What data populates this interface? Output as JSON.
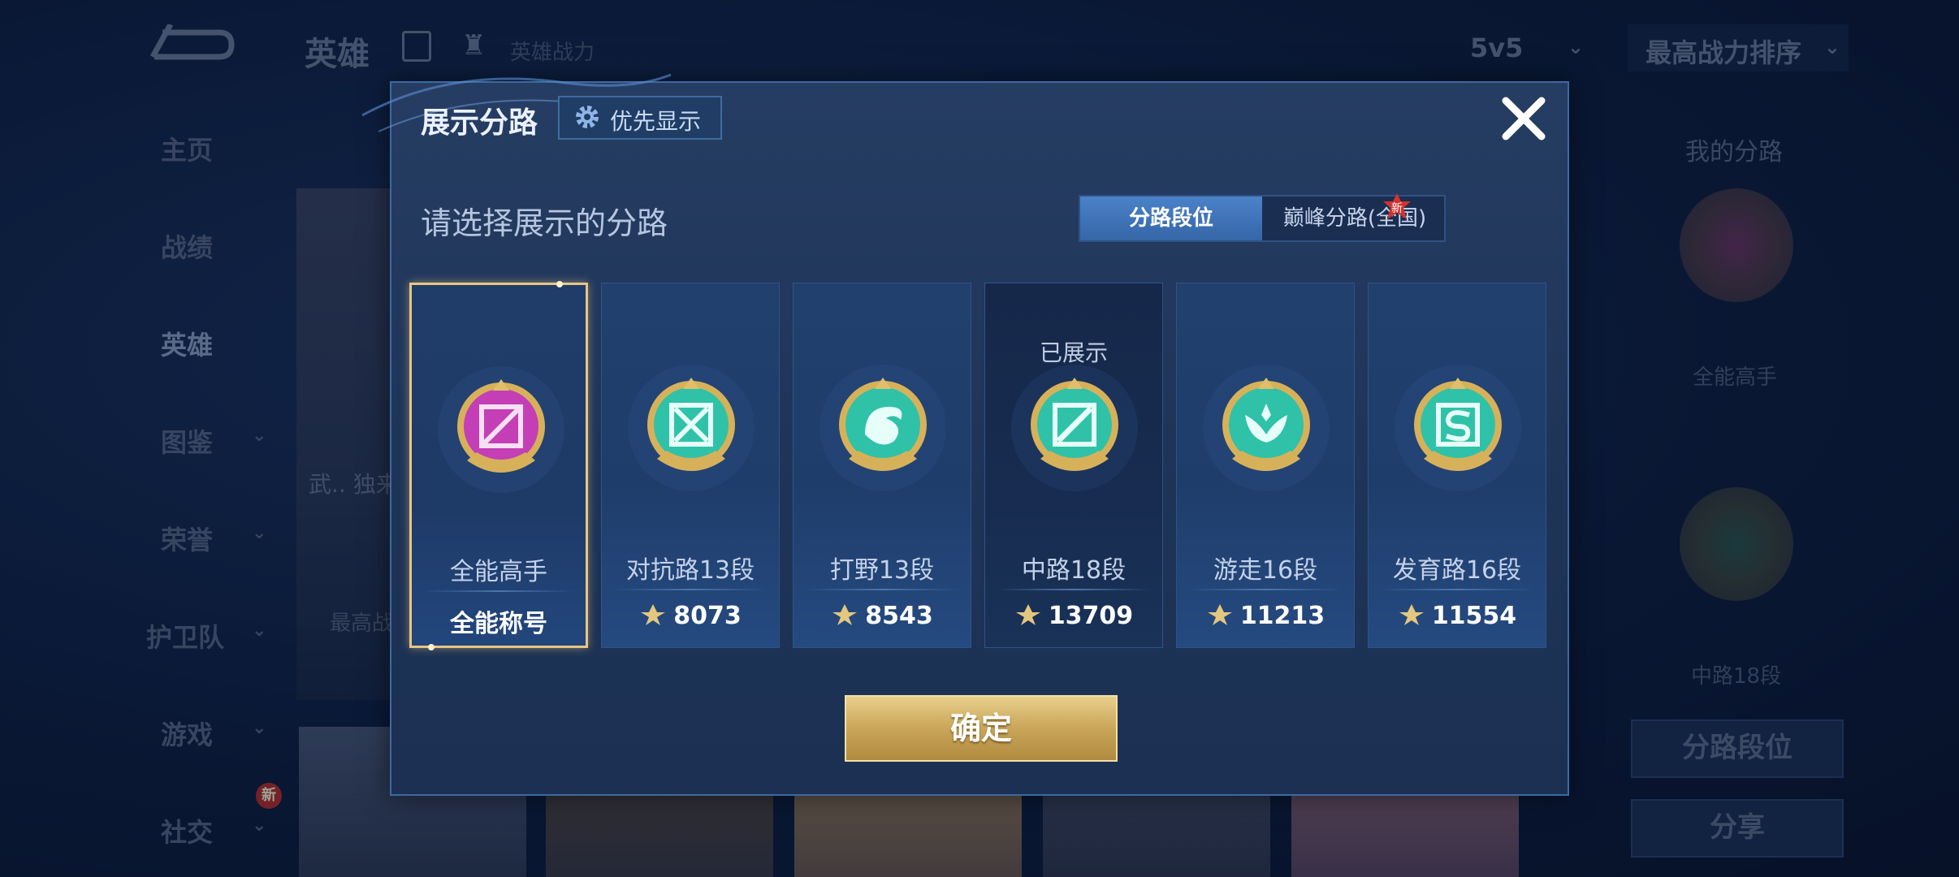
{
  "background": {
    "top_bar": {
      "title": "英雄",
      "power_label": "英雄战力",
      "mode_select": "5v5",
      "sort_select": "最高战力排序"
    },
    "side_nav": [
      {
        "label": "主页"
      },
      {
        "label": "战绩"
      },
      {
        "label": "英雄"
      },
      {
        "label": "图鉴"
      },
      {
        "label": "荣誉"
      },
      {
        "label": "护卫队"
      },
      {
        "label": "游戏"
      },
      {
        "label": "社交",
        "badge": "新"
      }
    ],
    "hero_card": {
      "caption": "武.. 独来独往",
      "stats": "最高战 英雄玩 英雄胜"
    },
    "right_panel": {
      "title": "我的分路",
      "badge1_label": "全能高手",
      "badge2_label": "中路18段",
      "lane_rank_button": "分路段位",
      "share_button": "分享"
    }
  },
  "modal": {
    "title": "展示分路",
    "pref_button": "优先显示",
    "subtitle": "请选择展示的分路",
    "tabs": [
      {
        "label": "分路段位",
        "active": true
      },
      {
        "label": "巅峰分路(全国)",
        "active": false
      }
    ],
    "new_badge": "新",
    "lanes": [
      {
        "name": "全能高手",
        "value": "全能称号",
        "selected": true,
        "shown": false,
        "emblem": "all-round-emblem",
        "color": "#c43fb5"
      },
      {
        "name": "对抗路13段",
        "value": "8073",
        "selected": false,
        "shown": false,
        "emblem": "clash-lane-emblem",
        "color": "#2fc2a8"
      },
      {
        "name": "打野13段",
        "value": "8543",
        "selected": false,
        "shown": false,
        "emblem": "jungle-emblem",
        "color": "#2fc2a8"
      },
      {
        "name": "中路18段",
        "value": "13709",
        "selected": false,
        "shown": true,
        "shown_label": "已展示",
        "emblem": "mid-lane-emblem",
        "color": "#2fc2a8"
      },
      {
        "name": "游走16段",
        "value": "11213",
        "selected": false,
        "shown": false,
        "emblem": "roam-emblem",
        "color": "#2fc2a8"
      },
      {
        "name": "发育路16段",
        "value": "11554",
        "selected": false,
        "shown": false,
        "emblem": "farm-lane-emblem",
        "color": "#2fc2a8"
      }
    ],
    "confirm_button": "确定"
  }
}
